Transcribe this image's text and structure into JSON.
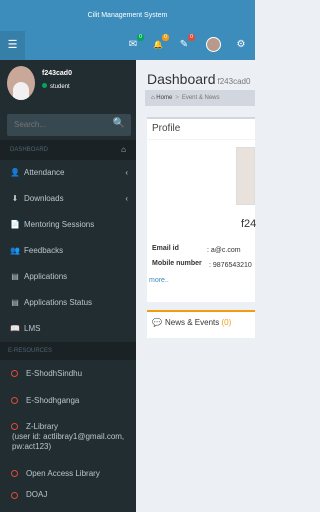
{
  "app_title": "Cilit Management System",
  "navbar": {
    "menu_icon": "☰",
    "mail_icon": "✉",
    "mail_badge": "0",
    "bell_icon": "🔔",
    "bell_badge": "0",
    "edit_icon": "✎",
    "edit_badge": "0",
    "settings_icon": "⚙",
    "colors": {
      "bar": "#3c8dbc",
      "mail_badge": "#00a65a",
      "bell_badge": "#f39c12",
      "edit_badge": "#dd4b39"
    }
  },
  "user": {
    "name": "f243cad0",
    "status": "student"
  },
  "search": {
    "placeholder": "Search...",
    "icon": "🔍"
  },
  "menu": {
    "header": "DASHBOARD",
    "header_icon": "⌂",
    "items": [
      {
        "label": "Attendance",
        "icon": "👤",
        "chevron": "‹"
      },
      {
        "label": "Downloads",
        "icon": "⬇",
        "chevron": "‹"
      },
      {
        "label": "Mentoring Sessions",
        "icon": "📄"
      },
      {
        "label": "Feedbacks",
        "icon": "👥"
      },
      {
        "label": "Applications",
        "icon": "▤"
      },
      {
        "label": "Applications Status",
        "icon": "▤"
      },
      {
        "label": "LMS",
        "icon": "📖"
      }
    ]
  },
  "eresources": {
    "header": "E-RESOURCES",
    "items": [
      {
        "label": "E-ShodhSindhu"
      },
      {
        "label": "E-Shodhganga"
      },
      {
        "label": "Z-Library"
      },
      {
        "label": "Open Access Library"
      },
      {
        "label": "DOAJ"
      }
    ],
    "zlibrary_line2": "(user id: actlibray1@gmail.com,",
    "zlibrary_line3": "pw:act123)"
  },
  "page": {
    "title": "Dashboard",
    "subtitle": "f243cad0"
  },
  "breadcrumb": {
    "home": "Home",
    "current": "Event & News"
  },
  "profile": {
    "title": "Profile",
    "name": "f24",
    "email_label": "Email id",
    "email_value": ": a@c.com",
    "mobile_label": "Mobile number",
    "mobile_value": ": 9876543210",
    "more_link": "more.."
  },
  "news": {
    "label": "News & Events",
    "count": "(0)",
    "icon": "💬"
  }
}
